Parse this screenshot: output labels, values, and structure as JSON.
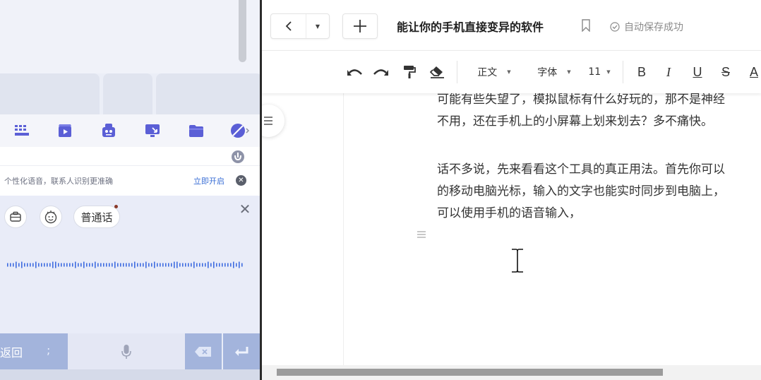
{
  "keyboard": {
    "banner": {
      "text": "个性化语音，联系人识别更准确",
      "link": "立即开启"
    },
    "voice": {
      "dialect_label": "普通话"
    },
    "bottom": {
      "back_label": "返回",
      "semicolon": ";"
    },
    "colors": {
      "accent": "#5b5fd6",
      "key_blue": "#a3b4dc",
      "link_blue": "#3b6fd6"
    }
  },
  "editor": {
    "title": "能让你的手机直接变异的软件",
    "save_status": "自动保存成功",
    "toolbar": {
      "paragraph_style": "正文",
      "font_family": "字体",
      "font_size": "11",
      "bold": "B",
      "italic": "I",
      "underline": "U",
      "strike": "S",
      "color": "A"
    },
    "content": {
      "lines": [
        "可能有些失望了，模拟鼠标有什么好玩的，那不是神经",
        "不用，还在手机上的小屏幕上划来划去？多不痛快。",
        "话不多说，先来看看这个工具的真正用法。首先你可以",
        "的移动电脑光标，输入的文字也能实时同步到电脑上，",
        "可以使用手机的语音输入，"
      ]
    }
  }
}
